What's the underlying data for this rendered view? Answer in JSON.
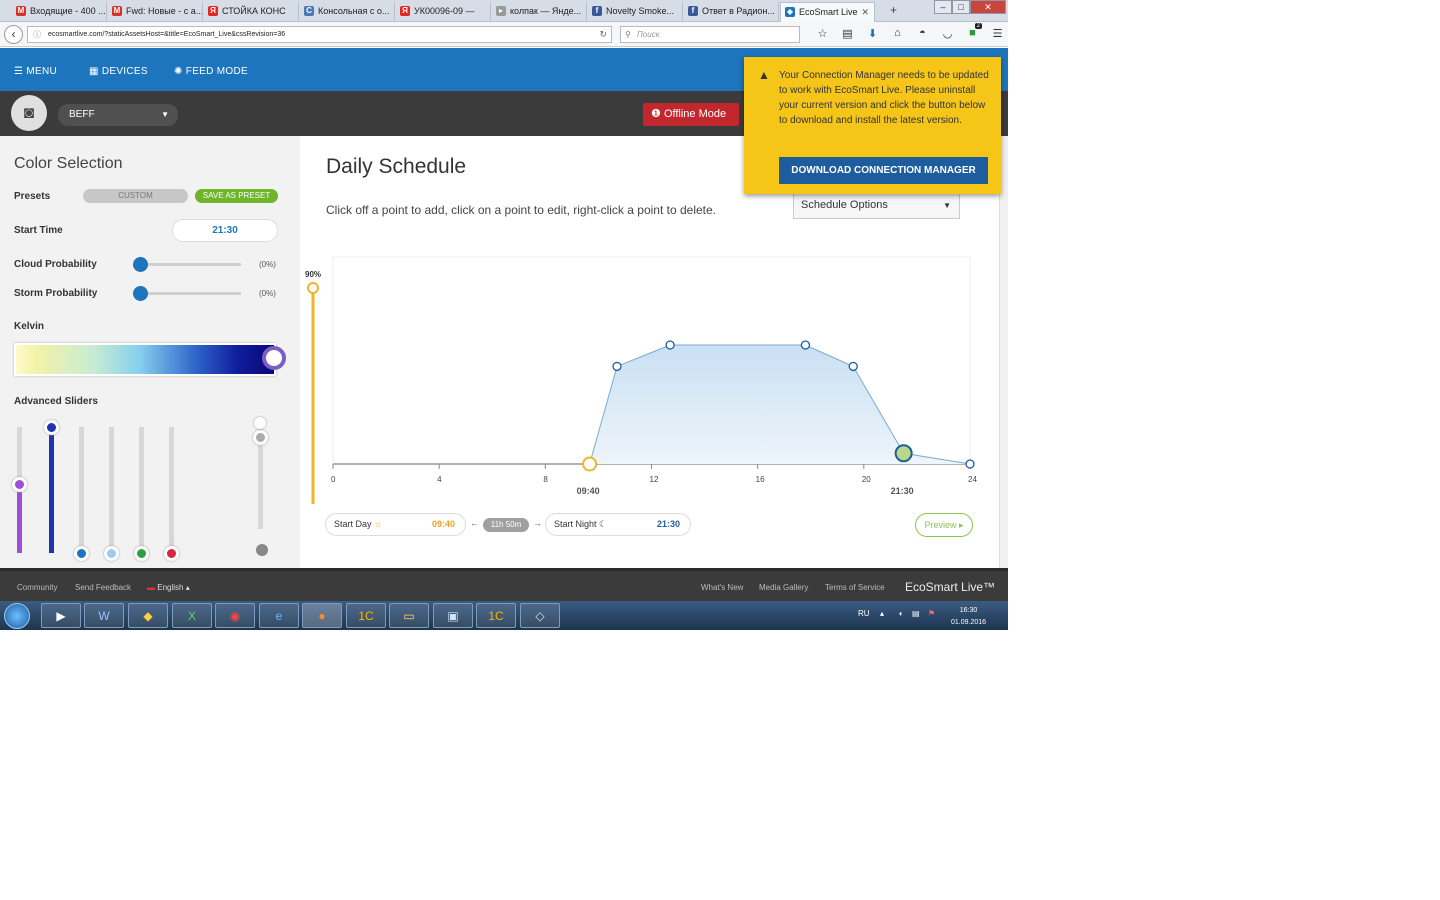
{
  "browser": {
    "tabs": [
      {
        "label": "Входящие - 400 ...",
        "icon": "gmail-icon",
        "color": "#d93025",
        "glyph": "M"
      },
      {
        "label": "Fwd: Новые - c а...",
        "icon": "gmail-icon",
        "color": "#d93025",
        "glyph": "M"
      },
      {
        "label": "СТОЙКА КОНС",
        "icon": "yandex-icon",
        "color": "#e52620",
        "glyph": "Я"
      },
      {
        "label": "Консольная с о...",
        "icon": "doc-icon",
        "color": "#4a7ab5",
        "glyph": "C"
      },
      {
        "label": "УК00096-09 —",
        "icon": "yandex-icon",
        "color": "#e52620",
        "glyph": "Я"
      },
      {
        "label": "колпак — Янде...",
        "icon": "page-icon",
        "color": "#999999",
        "glyph": "▸"
      },
      {
        "label": "Novelty Smoke...",
        "icon": "facebook-icon",
        "color": "#3b5998",
        "glyph": "f"
      },
      {
        "label": "Ответ в Радион...",
        "icon": "facebook-icon",
        "color": "#3b5998",
        "glyph": "f"
      },
      {
        "label": "EcoSmart Live",
        "icon": "ecosmart-icon",
        "color": "#1d75bd",
        "glyph": "◆"
      }
    ],
    "new_tab": "+",
    "url": "ecosmartlive.com/?staticAssetsHost=&title=EcoSmart_Live&cssRevision=36",
    "search_placeholder": "Поиск",
    "toolbar_icons": [
      "star-icon",
      "reading-list-icon",
      "download-icon",
      "home-icon",
      "sync-icon",
      "pocket-icon",
      "extension-icon",
      "menu-icon"
    ],
    "extension_badge": "2"
  },
  "app": {
    "nav": {
      "menu": "MENU",
      "devices": "DEVICES",
      "feed": "FEED MODE"
    },
    "group_name": "BEFF",
    "offline_label": "Offline Mode"
  },
  "color_selection": {
    "title": "Color Selection",
    "presets_label": "Presets",
    "custom_label": "CUSTOM",
    "save_preset_label": "SAVE AS PRESET",
    "start_time_label": "Start Time",
    "start_time_value": "21:30",
    "cloud_label": "Cloud Probability",
    "cloud_value": "(0%)",
    "storm_label": "Storm Probability",
    "storm_value": "(0%)",
    "kelvin_label": "Kelvin",
    "advanced_label": "Advanced Sliders",
    "sliders": [
      {
        "name": "violet",
        "color": "#9b4fd6",
        "level": 0.55
      },
      {
        "name": "royal-blue",
        "color": "#1f34b0",
        "level": 1.0
      },
      {
        "name": "blue",
        "color": "#1d75bd",
        "level": 0.0
      },
      {
        "name": "light-blue",
        "color": "#9fc9f0",
        "level": 0.0
      },
      {
        "name": "green",
        "color": "#2ea043",
        "level": 0.0
      },
      {
        "name": "red",
        "color": "#d7263d",
        "level": 0.0
      },
      {
        "name": "white",
        "color": "#aaaaaa",
        "level": 0.82
      }
    ]
  },
  "schedule": {
    "title": "Daily Schedule",
    "hint": "Click off a point to add, click on a point to edit, right-click a point to delete.",
    "options_label": "Schedule Options",
    "max_label": "90%",
    "x_ticks": [
      "0",
      "4",
      "8",
      "12",
      "16",
      "20",
      "24"
    ],
    "marker_start": "09:40",
    "marker_end": "21:30",
    "start_day_label": "Start Day",
    "start_day_value": "09:40",
    "duration": "11h 50m",
    "start_night_label": "Start Night",
    "start_night_value": "21:30",
    "preview_label": "Preview",
    "arrow_left": "←",
    "arrow_right": "→"
  },
  "chart_data": {
    "type": "area",
    "title": "Daily Schedule",
    "xlabel": "",
    "ylabel": "",
    "xlim": [
      0,
      24
    ],
    "x": [
      9.67,
      10.7,
      12.7,
      17.8,
      19.6,
      21.5,
      24
    ],
    "y": [
      0,
      82,
      100,
      100,
      82,
      9,
      0
    ],
    "grid": false
  },
  "notice": {
    "message": "Your Connection Manager needs to be updated to work with EcoSmart Live. Please uninstall your current version and click the button below to download and install the latest version.",
    "button": "DOWNLOAD CONNECTION MANAGER"
  },
  "footer": {
    "community": "Community",
    "feedback": "Send Feedback",
    "language": "English ▴",
    "whats_new": "What's New",
    "gallery": "Media Gallery",
    "terms": "Terms of Service",
    "brand": "EcoSmart Live™"
  },
  "taskbar": {
    "lang": "RU",
    "time": "16:30",
    "date": "01.09.2016"
  }
}
